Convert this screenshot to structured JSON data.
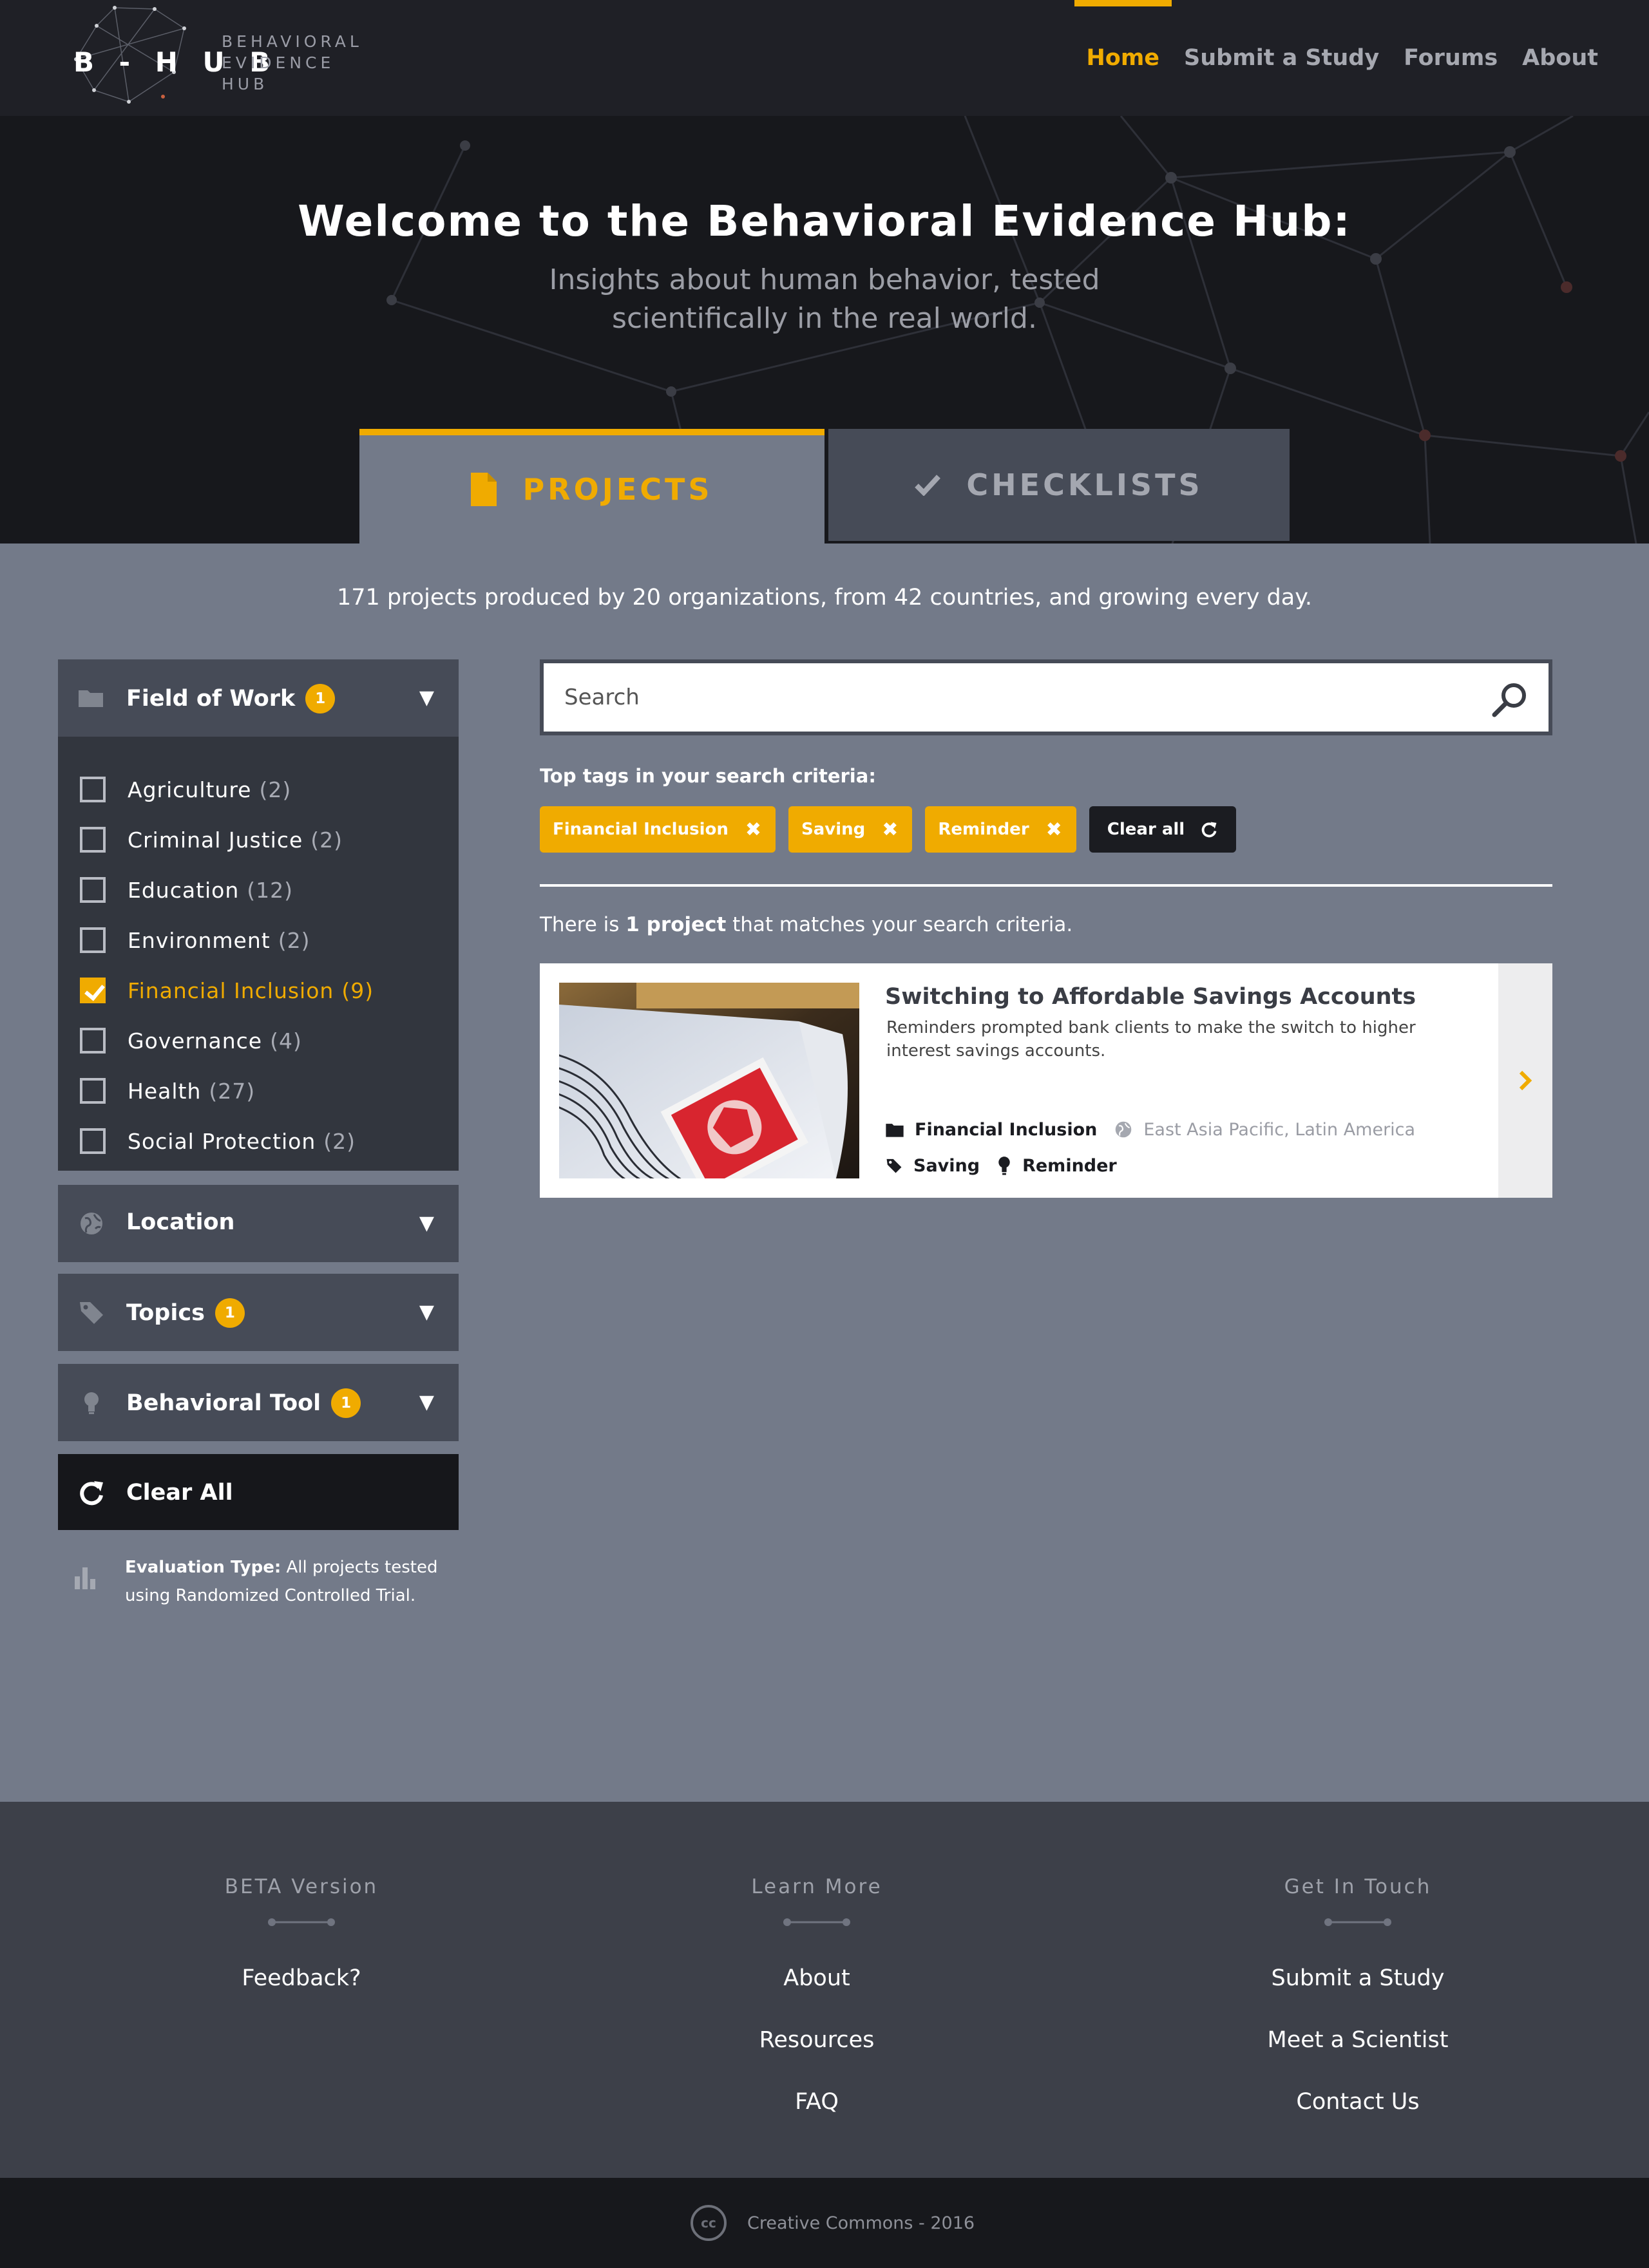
{
  "header": {
    "logo_text": "B - H U B",
    "logo_sub": "BEHAVIORAL EVIDENCE HUB",
    "nav": [
      "Home",
      "Submit a Study",
      "Forums",
      "About"
    ],
    "active_nav": "Home"
  },
  "hero": {
    "title": "Welcome to the Behavioral Evidence Hub:",
    "subtitle": "Insights about human behavior, tested scientifically in the real world."
  },
  "tabs": {
    "projects": "PROJECTS",
    "checklists": "CHECKLISTS"
  },
  "stats": "171 projects produced by 20 organizations, from 42 countries, and growing every day.",
  "filters": {
    "field_of_work": {
      "label": "Field of Work",
      "badge": "1",
      "items": [
        {
          "label": "Agriculture",
          "count": "(2)",
          "checked": false
        },
        {
          "label": "Criminal Justice",
          "count": "(2)",
          "checked": false
        },
        {
          "label": "Education",
          "count": "(12)",
          "checked": false
        },
        {
          "label": "Environment",
          "count": "(2)",
          "checked": false
        },
        {
          "label": "Financial Inclusion",
          "count": "(9)",
          "checked": true
        },
        {
          "label": "Governance",
          "count": "(4)",
          "checked": false
        },
        {
          "label": "Health",
          "count": "(27)",
          "checked": false
        },
        {
          "label": "Social Protection",
          "count": "(2)",
          "checked": false
        }
      ]
    },
    "location": {
      "label": "Location"
    },
    "topics": {
      "label": "Topics",
      "badge": "1"
    },
    "behavioral_tool": {
      "label": "Behavioral Tool",
      "badge": "1"
    },
    "clear_all": "Clear All",
    "evaluation_label": "Evaluation Type:",
    "evaluation_text": "All projects tested using Randomized Controlled Trial."
  },
  "search": {
    "placeholder": "Search",
    "top_tags_title": "Top tags in your search criteria:",
    "tags": [
      "Financial Inclusion",
      "Saving",
      "Reminder"
    ],
    "clear_all": "Clear all"
  },
  "results": {
    "prefix": "There is",
    "count": "1 project",
    "suffix": "that matches your search criteria.",
    "items": [
      {
        "title": "Switching to Affordable Savings Accounts",
        "description": "Reminders prompted bank clients to make the switch to higher interest savings accounts.",
        "field": "Financial Inclusion",
        "locations": "East Asia Pacific,  Latin America",
        "topic": "Saving",
        "tool": "Reminder"
      }
    ]
  },
  "footer": {
    "columns": [
      {
        "heading": "BETA Version",
        "links": [
          "Feedback?"
        ]
      },
      {
        "heading": "Learn More",
        "links": [
          "About",
          "Resources",
          "FAQ"
        ]
      },
      {
        "heading": "Get In Touch",
        "links": [
          "Submit a Study",
          "Meet a Scientist",
          "Contact Us"
        ]
      }
    ],
    "copyright": "Creative Commons - 2016"
  },
  "colors": {
    "accent": "#f0ab00",
    "header_bg": "#1f2026",
    "main_bg": "#737a89",
    "panel_bg": "#464b57",
    "panel_body_bg": "#32363e"
  }
}
